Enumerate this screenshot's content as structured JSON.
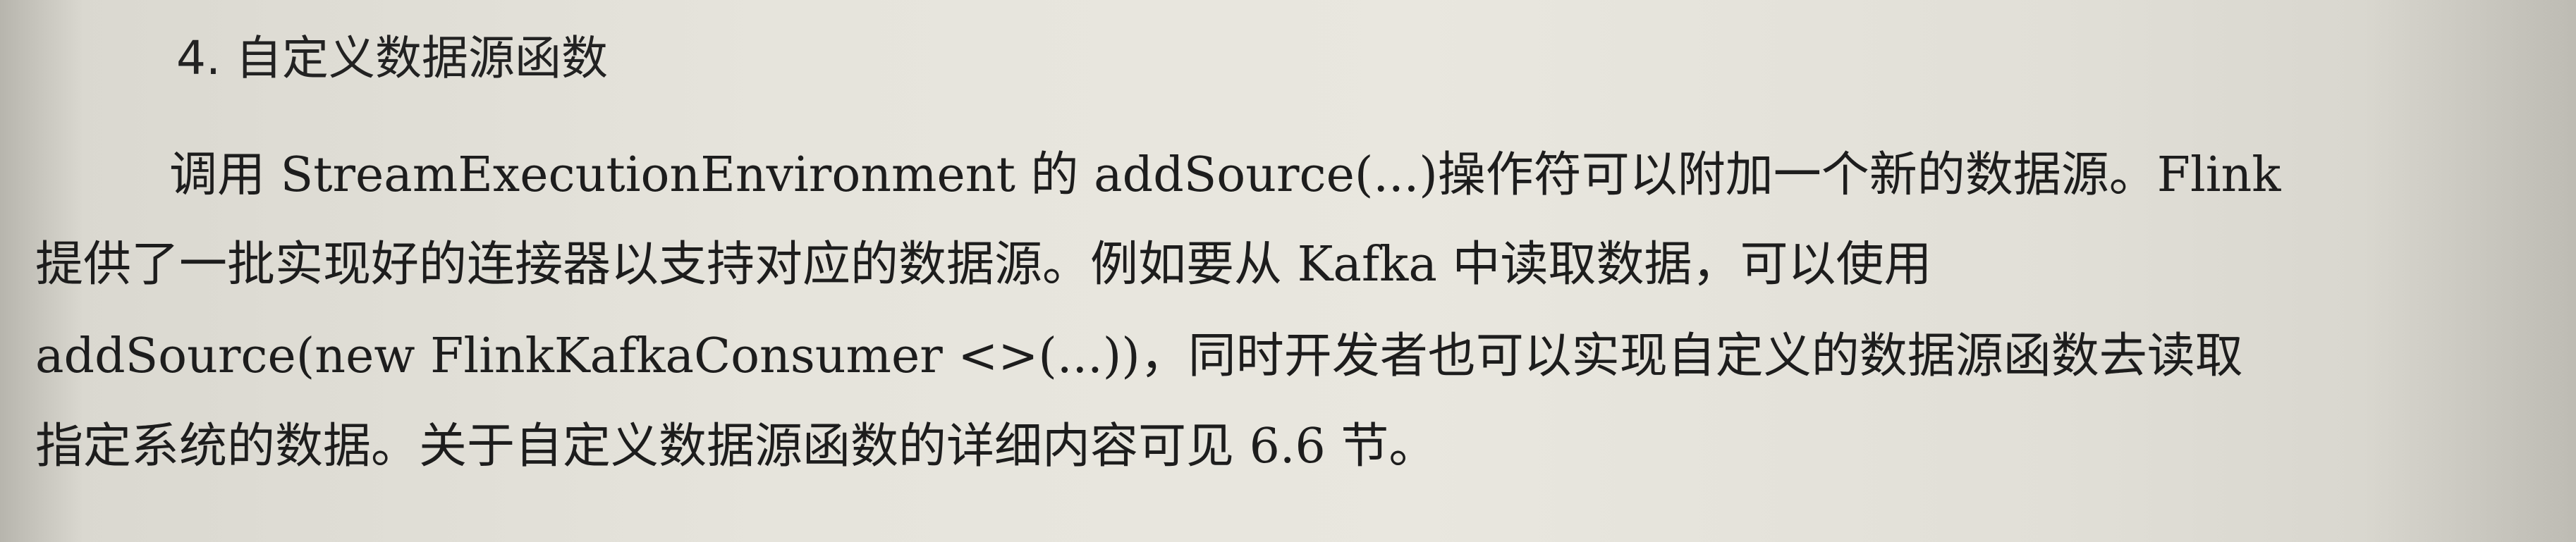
{
  "section": {
    "heading": "4. 自定义数据源函数",
    "lines": [
      "调用 StreamExecutionEnvironment 的 addSource(...)操作符可以附加一个新的数据源。Flink",
      "提供了一批实现好的连接器以支持对应的数据源。例如要从 Kafka 中读取数据，可以使用",
      "addSource(new FlinkKafkaConsumer <>(...))，同时开发者也可以实现自定义的数据源函数去读取",
      "指定系统的数据。关于自定义数据源函数的详细内容可见 6.6 节。"
    ]
  }
}
